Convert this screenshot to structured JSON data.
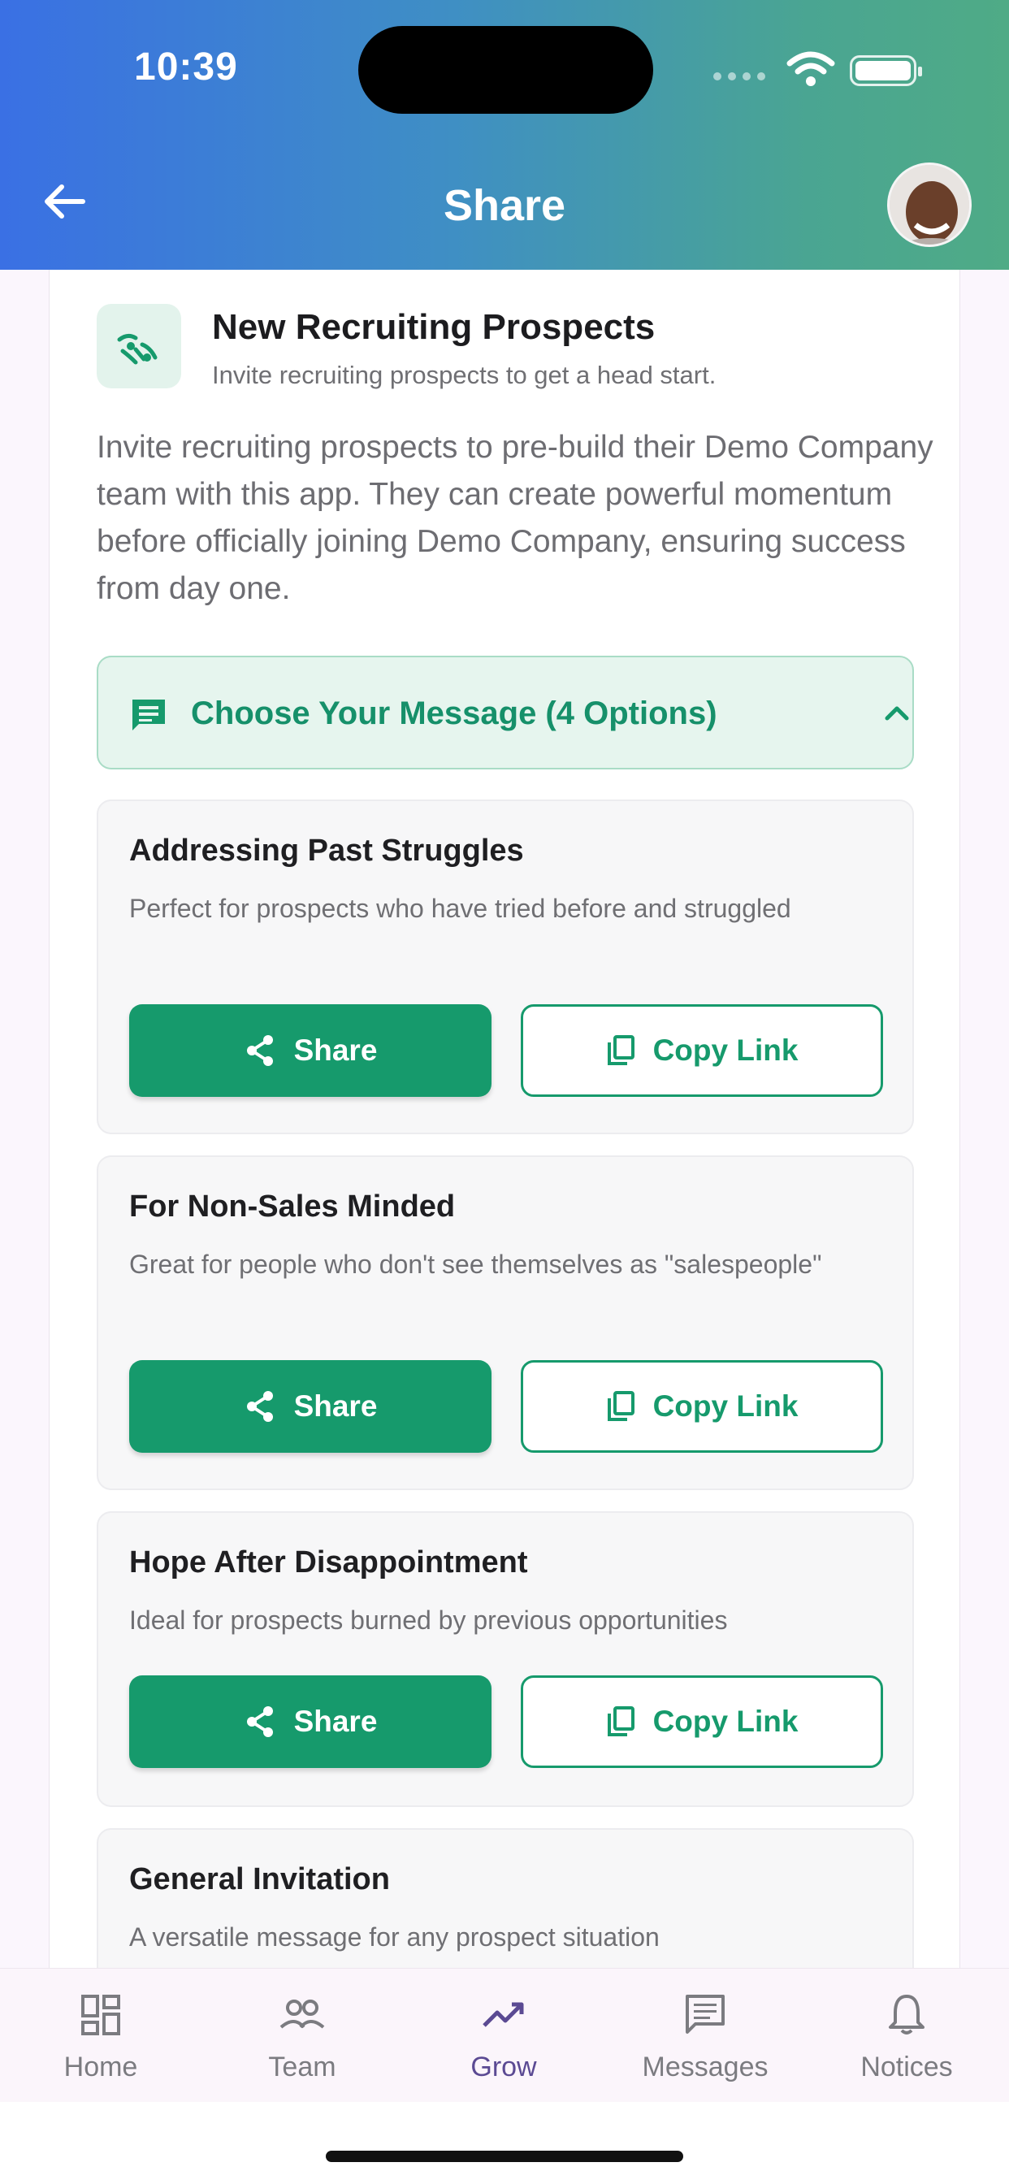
{
  "status_bar": {
    "time": "10:39"
  },
  "header": {
    "title": "Share"
  },
  "feature": {
    "title": "New Recruiting Prospects",
    "subtitle": "Invite recruiting prospects to get a head start.",
    "description": "Invite recruiting prospects to pre-build their Demo Company team with this app. They can create powerful momentum before officially joining Demo Company, ensuring success from day one."
  },
  "choose": {
    "label": "Choose Your Message (4 Options)"
  },
  "options": [
    {
      "title": "Addressing Past Struggles",
      "desc": "Perfect for prospects who have tried before and struggled",
      "share": "Share",
      "copy": "Copy Link"
    },
    {
      "title": "For Non-Sales Minded",
      "desc": "Great for people who don't see themselves as \"salespeople\"",
      "share": "Share",
      "copy": "Copy Link"
    },
    {
      "title": "Hope After Disappointment",
      "desc": "Ideal for prospects burned by previous opportunities",
      "share": "Share",
      "copy": "Copy Link"
    },
    {
      "title": "General Invitation",
      "desc": "A versatile message for any prospect situation"
    }
  ],
  "nav": [
    {
      "label": "Home",
      "icon": "dashboard-icon"
    },
    {
      "label": "Team",
      "icon": "people-icon"
    },
    {
      "label": "Grow",
      "icon": "trending-up-icon",
      "active": true
    },
    {
      "label": "Messages",
      "icon": "message-icon"
    },
    {
      "label": "Notices",
      "icon": "bell-icon"
    }
  ],
  "colors": {
    "accent": "#169a6c",
    "active_nav": "#5b4a93"
  }
}
